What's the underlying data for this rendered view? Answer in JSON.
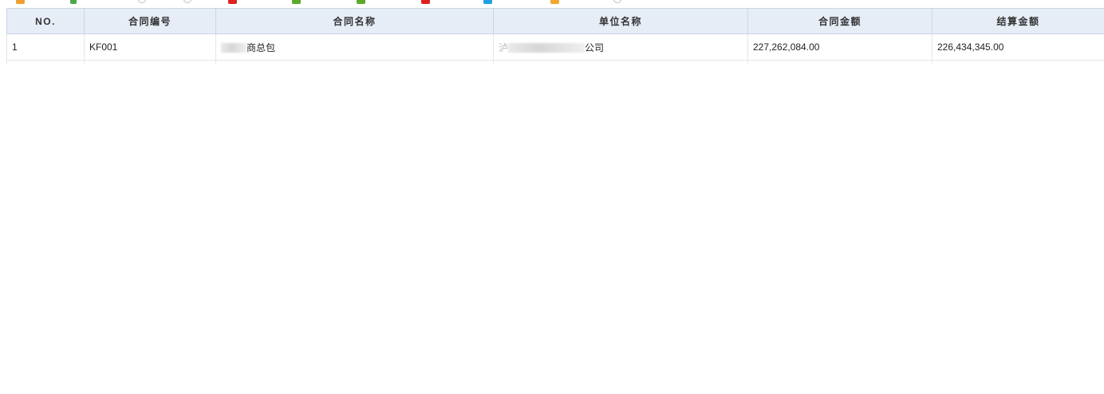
{
  "toolbar": {
    "icons": [
      {
        "name": "star-icon",
        "color": "#f0a030"
      },
      {
        "name": "add-icon",
        "color": "#4aa84a"
      },
      {
        "name": "circle-icon",
        "color": "#bdbdbd"
      },
      {
        "name": "circle-icon",
        "color": "#bdbdbd"
      },
      {
        "name": "delete-icon",
        "color": "#e02020"
      },
      {
        "name": "square-icon",
        "color": "#5aaa2a"
      },
      {
        "name": "square-icon",
        "color": "#5aaa2a"
      },
      {
        "name": "delete-icon",
        "color": "#e02020"
      },
      {
        "name": "info-icon",
        "color": "#20a0e0"
      },
      {
        "name": "folder-icon",
        "color": "#f0a830"
      },
      {
        "name": "circle-icon",
        "color": "#bdbdbd"
      }
    ]
  },
  "table": {
    "headers": {
      "no": "NO.",
      "contract_no": "合同编号",
      "contract_name": "合同名称",
      "unit_name": "单位名称",
      "contract_amount": "合同金额",
      "settlement_amount": "结算金额"
    },
    "rows": [
      {
        "no": "1",
        "contract_no": "KF001",
        "contract_name_visible": "商总包",
        "unit_name_prefix": "泸",
        "unit_name_suffix": "公司",
        "contract_amount": "227,262,084.00",
        "settlement_amount": "226,434,345.00"
      }
    ]
  }
}
